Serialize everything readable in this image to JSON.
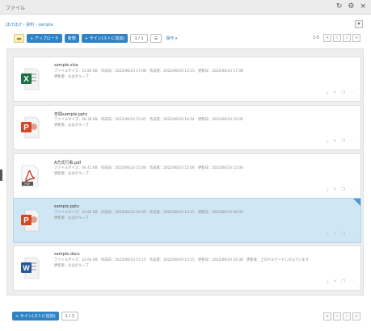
{
  "window": {
    "title": "ファイル"
  },
  "breadcrumb": "ほげほげ › 資料 › sample",
  "toolbar": {
    "folder_icon": "folder-icon",
    "upload_label": "+ アップロード",
    "new_label": "新規",
    "signature_label": "+ サイン(ストに追加)",
    "page_label": "1 / 1",
    "view_label": "表示",
    "more_label": "操作 ▾"
  },
  "pager": {
    "count": "1-5"
  },
  "files": [
    {
      "name": "sample.xlsx",
      "type": "excel",
      "meta": "ファイルサイズ：12.85 KB　作成日：2022/06/23 17:08　作成者：2022/06/19 13:15　更新日：2022/06/23 17:08",
      "owner": "更新者：ほほグループ"
    },
    {
      "name": "年間sample.pptx",
      "type": "powerpoint",
      "meta": "ファイルサイズ：26.36 KB　作成日：2022/06/23 15:05　作成者：2022/06/19 16:54　更新日：2022/06/23 15:06",
      "owner": "更新者：ほほグループ"
    },
    {
      "name": "A方式行事.pdf",
      "type": "pdf",
      "meta": "ファイルサイズ：44.41 KB　作成日：2022/06/23 15:06　作成者：2022/06/23 15:06　更新日：2022/06/23 15:06",
      "owner": "更新者：ほほグループ"
    },
    {
      "name": "sample.pptx",
      "type": "powerpoint",
      "meta": "ファイルサイズ：41.82 KB　作成日：2022/06/23 06:09　作成者：2022/06/19 13:15　更新日：2022/06/24 06:09",
      "owner": "更新者：ほほグループ"
    },
    {
      "name": "sample.docx",
      "type": "word",
      "meta": "ファイルサイズ：22.64 KB　作成日：2022/06/14 15:15　作成者：2022/06/19 13:15　更新日：2022/06/20 16:38　更新者：上司ベルナードしけんでいます",
      "owner": "更新者：ほほグループ"
    }
  ],
  "footer": {
    "signature_label": "+ サイン(ストに追加)",
    "page_label": "1 / 1"
  },
  "colors": {
    "accent": "#2f83c5",
    "selected": "#cfe6f5",
    "excel": "#1e7145",
    "ppt": "#d24726",
    "pdf": "#c8231e",
    "word": "#2b579a"
  }
}
